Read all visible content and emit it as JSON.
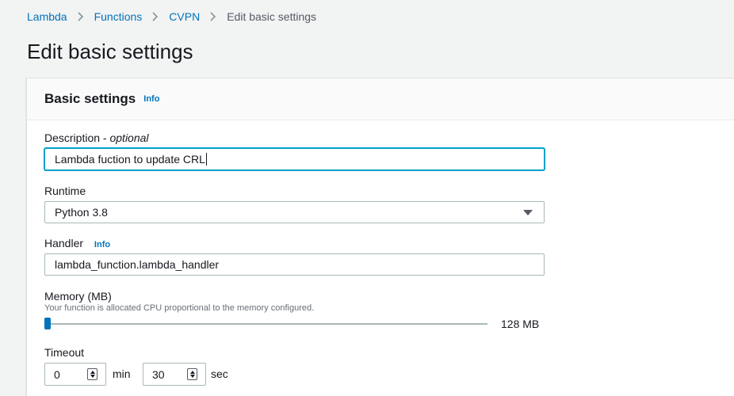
{
  "breadcrumb": {
    "items": [
      "Lambda",
      "Functions",
      "CVPN"
    ],
    "current": "Edit basic settings"
  },
  "page_title": "Edit basic settings",
  "panel": {
    "title": "Basic settings",
    "info": "Info"
  },
  "description": {
    "label": "Description",
    "optional": "optional",
    "value": "Lambda fuction to update CRL"
  },
  "runtime": {
    "label": "Runtime",
    "value": "Python 3.8"
  },
  "handler": {
    "label": "Handler",
    "info": "Info",
    "value": "lambda_function.lambda_handler"
  },
  "memory": {
    "label": "Memory (MB)",
    "hint": "Your function is allocated CPU proportional to the memory configured.",
    "value_text": "128 MB",
    "level": 0
  },
  "timeout": {
    "label": "Timeout",
    "min_value": "0",
    "min_unit": "min",
    "sec_value": "30",
    "sec_unit": "sec"
  },
  "colors": {
    "link": "#0073bb",
    "focus": "#00a1c9",
    "background": "#f2f3f3"
  }
}
